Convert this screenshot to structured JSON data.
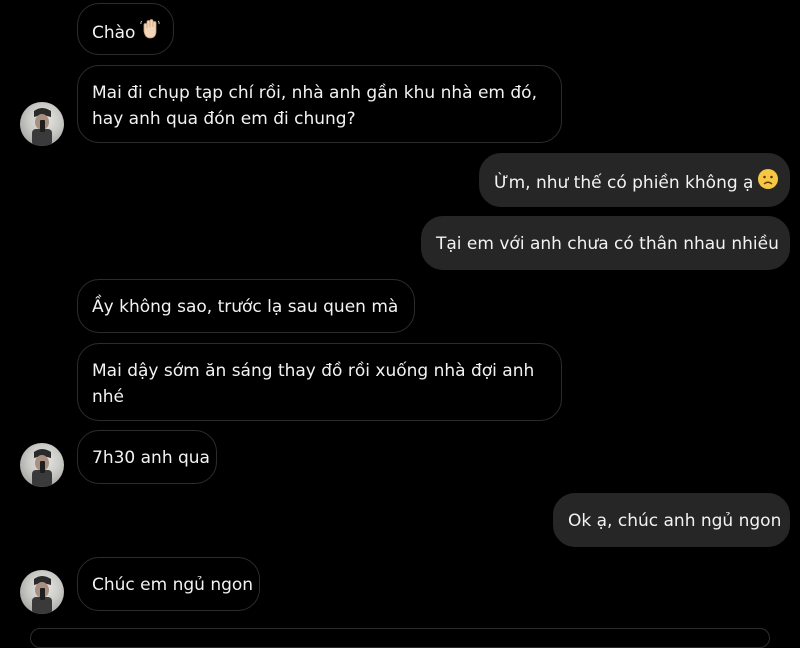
{
  "messages": [
    {
      "side": "in",
      "text": "Chào",
      "emoji": "waving-hand-icon"
    },
    {
      "side": "in",
      "text_line1": "Mai đi chụp tạp chí rồi, nhà anh gần khu nhà em đó,",
      "text_line2": "hay anh qua đón em đi chung?"
    },
    {
      "side": "out",
      "text": "Ừm, như thế có phiền không ạ",
      "emoji": "worried-face-icon"
    },
    {
      "side": "out",
      "text": "Tại em với anh chưa có thân nhau nhiều"
    },
    {
      "side": "in",
      "text": "Ầy không sao, trước lạ sau quen mà"
    },
    {
      "side": "in",
      "text_line1": "Mai dậy sớm ăn sáng thay đồ rồi xuống nhà đợi anh",
      "text_line2": "nhé"
    },
    {
      "side": "in",
      "text": "7h30 anh qua"
    },
    {
      "side": "out",
      "text": "Ok ạ, chúc anh ngủ ngon"
    },
    {
      "side": "in",
      "text": "Chúc em ngủ ngon"
    }
  ],
  "colors": {
    "background": "#000000",
    "incoming_border": "#2c2c2c",
    "outgoing_bubble": "#262626",
    "text": "#f2f2f2"
  }
}
